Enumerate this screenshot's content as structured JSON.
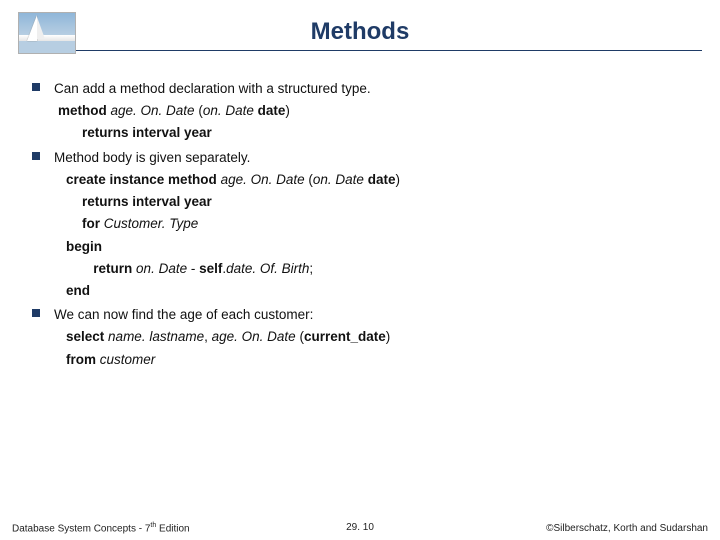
{
  "title": "Methods",
  "bullets": [
    {
      "lead": "Can add a method declaration with a structured type.",
      "lines": [
        {
          "cls": "sub1",
          "html": "<span class='b'>method</span> <span class='i'>age. On. Date</span> (<span class='i'>on. Date</span> <span class='b'>date</span>)"
        },
        {
          "cls": "sub2",
          "html": "<span class='b'>returns interval year</span>"
        }
      ]
    },
    {
      "lead": "Method body is given separately.",
      "lines": [
        {
          "cls": "sub3",
          "html": "<span class='b'>create instance method</span> <span class='i'>age. On. Date</span> (<span class='i'>on. Date</span> <span class='b'>date</span>)"
        },
        {
          "cls": "sub2",
          "html": "<span class='b'>returns interval year</span>"
        },
        {
          "cls": "sub2",
          "html": "<span class='b'>for</span> <span class='i'>Customer. Type</span>"
        },
        {
          "cls": "sub3",
          "html": "<span class='b'>begin</span>"
        },
        {
          "cls": "sub2",
          "html": "&nbsp;&nbsp;&nbsp;<span class='b'>return</span> <span class='i'>on. Date</span> - <span class='b'>self</span>.<span class='i'>date. Of. Birth</span>;"
        },
        {
          "cls": "sub3",
          "html": "<span class='b'>end</span>"
        }
      ]
    },
    {
      "lead": "We can now find the age of each customer:",
      "lines": [
        {
          "cls": "sub3",
          "html": "<span class='b'>select</span> <span class='i'>name.</span> <span class='i'>lastname</span>, <span class='i'>age. On. Date</span> (<span class='b'>current_date</span>)"
        },
        {
          "cls": "sub3",
          "html": "<span class='b'>from</span> <span class='i'>customer</span>"
        }
      ]
    }
  ],
  "footer": {
    "left_a": "Database System Concepts - 7",
    "left_b": " Edition",
    "sup": "th",
    "center": "29. 10",
    "right": "©Silberschatz, Korth and Sudarshan"
  }
}
